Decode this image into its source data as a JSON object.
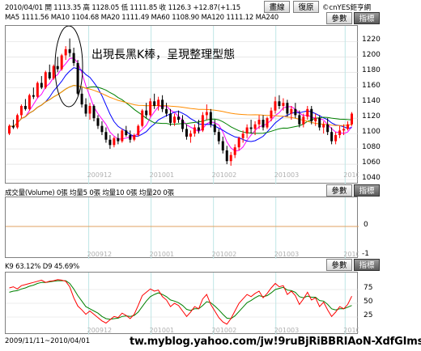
{
  "header": {
    "quote_line": "2010/04/01 開 1113.35 高 1128.05 低 1111.85 收 1126.3 +12.87(+1.15",
    "ma_line": "MA5 1111.56   MA10 1104.68   MA20 1111.49   MA60 1108.90   MA120 1111.12   MA240"
  },
  "toolbar": {
    "draw_line": "畫線",
    "restore": "復原",
    "params": "參數",
    "indicator": "指標"
  },
  "copyright": "©cnYES鉅亨網",
  "annotation": "出現長黑K棒，呈現整理型態",
  "volume_panel": {
    "header": "成交量(Volume) 0張    均量5 0張    均量10 0張    均量20 0張",
    "params": "參數",
    "indicator": "指標"
  },
  "kd_panel": {
    "header": "K9 63.12%   D9 45.69%",
    "params": "參數",
    "indicator": "指標"
  },
  "footer": {
    "range": "2009/11/11~2010/04/01",
    "watermark": "tw.myblog.yahoo.com/jw!9ruBjRiBBRIAoN-XdfGImss-",
    "faint_url": "www.cnyes.com"
  },
  "chart_data": [
    {
      "type": "candlestick",
      "y_ticks": [
        1220,
        1200,
        1180,
        1160,
        1140,
        1120,
        1100,
        1080,
        1060,
        1040
      ],
      "ylim": [
        1040,
        1232
      ],
      "x_labels": [
        "200912",
        "201001",
        "201002",
        "201003",
        "201004"
      ],
      "grid": true,
      "up_color": "#ff0000",
      "down_color": "#000000",
      "ma_lines": [
        {
          "name": "MA5",
          "color": "#ff00ff"
        },
        {
          "name": "MA10",
          "color": "#0000ff"
        },
        {
          "name": "MA20",
          "color": "#008000"
        },
        {
          "name": "MA60",
          "color": "#ff8c00"
        }
      ],
      "candles": [
        [
          1100,
          1112,
          1098,
          1110
        ],
        [
          1110,
          1118,
          1106,
          1108
        ],
        [
          1108,
          1126,
          1106,
          1124
        ],
        [
          1124,
          1138,
          1120,
          1136
        ],
        [
          1136,
          1145,
          1130,
          1132
        ],
        [
          1132,
          1152,
          1130,
          1150
        ],
        [
          1150,
          1160,
          1145,
          1148
        ],
        [
          1148,
          1168,
          1146,
          1166
        ],
        [
          1166,
          1175,
          1158,
          1160
        ],
        [
          1160,
          1182,
          1158,
          1180
        ],
        [
          1180,
          1190,
          1170,
          1172
        ],
        [
          1172,
          1190,
          1170,
          1188
        ],
        [
          1188,
          1200,
          1180,
          1184
        ],
        [
          1184,
          1204,
          1182,
          1202
        ],
        [
          1202,
          1214,
          1196,
          1210
        ],
        [
          1210,
          1224,
          1200,
          1205
        ],
        [
          1205,
          1212,
          1188,
          1192
        ],
        [
          1192,
          1196,
          1150,
          1152
        ],
        [
          1152,
          1160,
          1134,
          1138
        ],
        [
          1138,
          1146,
          1122,
          1126
        ],
        [
          1126,
          1140,
          1118,
          1136
        ],
        [
          1136,
          1138,
          1116,
          1120
        ],
        [
          1120,
          1124,
          1106,
          1110
        ],
        [
          1110,
          1116,
          1098,
          1102
        ],
        [
          1102,
          1108,
          1088,
          1092
        ],
        [
          1092,
          1098,
          1080,
          1085
        ],
        [
          1085,
          1096,
          1082,
          1094
        ],
        [
          1094,
          1100,
          1086,
          1090
        ],
        [
          1090,
          1106,
          1088,
          1104
        ],
        [
          1104,
          1110,
          1096,
          1098
        ],
        [
          1098,
          1104,
          1088,
          1092
        ],
        [
          1092,
          1100,
          1090,
          1098
        ],
        [
          1098,
          1112,
          1096,
          1110
        ],
        [
          1110,
          1132,
          1108,
          1130
        ],
        [
          1130,
          1140,
          1120,
          1124
        ],
        [
          1124,
          1146,
          1122,
          1142
        ],
        [
          1142,
          1152,
          1132,
          1136
        ],
        [
          1136,
          1148,
          1130,
          1144
        ],
        [
          1144,
          1150,
          1128,
          1132
        ],
        [
          1132,
          1140,
          1122,
          1126
        ],
        [
          1126,
          1132,
          1110,
          1114
        ],
        [
          1114,
          1126,
          1110,
          1122
        ],
        [
          1122,
          1130,
          1114,
          1118
        ],
        [
          1118,
          1124,
          1102,
          1106
        ],
        [
          1106,
          1112,
          1092,
          1096
        ],
        [
          1096,
          1104,
          1088,
          1100
        ],
        [
          1100,
          1112,
          1096,
          1108
        ],
        [
          1108,
          1118,
          1100,
          1104
        ],
        [
          1104,
          1128,
          1102,
          1124
        ],
        [
          1124,
          1138,
          1118,
          1128
        ],
        [
          1128,
          1132,
          1108,
          1112
        ],
        [
          1112,
          1118,
          1098,
          1102
        ],
        [
          1102,
          1106,
          1086,
          1090
        ],
        [
          1090,
          1096,
          1074,
          1078
        ],
        [
          1078,
          1084,
          1060,
          1064
        ],
        [
          1064,
          1076,
          1058,
          1072
        ],
        [
          1072,
          1086,
          1068,
          1082
        ],
        [
          1082,
          1096,
          1078,
          1094
        ],
        [
          1094,
          1104,
          1088,
          1100
        ],
        [
          1100,
          1112,
          1094,
          1108
        ],
        [
          1108,
          1118,
          1100,
          1106
        ],
        [
          1106,
          1116,
          1098,
          1112
        ],
        [
          1112,
          1124,
          1106,
          1118
        ],
        [
          1118,
          1124,
          1104,
          1108
        ],
        [
          1108,
          1122,
          1106,
          1120
        ],
        [
          1120,
          1134,
          1116,
          1130
        ],
        [
          1130,
          1148,
          1126,
          1142
        ],
        [
          1142,
          1150,
          1132,
          1136
        ],
        [
          1136,
          1146,
          1130,
          1140
        ],
        [
          1140,
          1144,
          1122,
          1126
        ],
        [
          1126,
          1136,
          1118,
          1132
        ],
        [
          1132,
          1140,
          1120,
          1124
        ],
        [
          1124,
          1130,
          1108,
          1112
        ],
        [
          1112,
          1126,
          1108,
          1122
        ],
        [
          1122,
          1136,
          1118,
          1132
        ],
        [
          1132,
          1136,
          1112,
          1116
        ],
        [
          1116,
          1126,
          1110,
          1120
        ],
        [
          1120,
          1124,
          1104,
          1108
        ],
        [
          1108,
          1116,
          1100,
          1112
        ],
        [
          1112,
          1120,
          1098,
          1102
        ],
        [
          1102,
          1108,
          1086,
          1090
        ],
        [
          1090,
          1102,
          1086,
          1098
        ],
        [
          1098,
          1110,
          1094,
          1104
        ],
        [
          1104,
          1112,
          1098,
          1106
        ],
        [
          1106,
          1116,
          1104,
          1112
        ],
        [
          1112,
          1128,
          1110,
          1126
        ]
      ]
    },
    {
      "type": "bar",
      "series": [
        {
          "name": "成交量(Volume)",
          "values": [
            0
          ]
        }
      ],
      "y_ticks": [
        0,
        -1
      ],
      "x_labels": [
        "200912",
        "201001",
        "201002",
        "201003",
        "201004"
      ]
    },
    {
      "type": "line",
      "series": [
        {
          "name": "K9",
          "color": "#ff0000"
        },
        {
          "name": "D9",
          "color": "#008000"
        }
      ],
      "y_ticks": [
        75,
        50,
        25
      ],
      "ylim": [
        0,
        100
      ],
      "x_labels": [
        "200912",
        "201001",
        "201002",
        "201003",
        "201004"
      ],
      "K": [
        78,
        80,
        76,
        82,
        84,
        86,
        88,
        90,
        92,
        88,
        90,
        91,
        93,
        92,
        90,
        80,
        60,
        45,
        38,
        30,
        36,
        30,
        24,
        18,
        14,
        20,
        26,
        24,
        32,
        28,
        22,
        30,
        46,
        64,
        70,
        76,
        72,
        74,
        62,
        56,
        44,
        50,
        46,
        36,
        26,
        34,
        44,
        40,
        58,
        66,
        48,
        36,
        24,
        16,
        12,
        22,
        36,
        50,
        58,
        66,
        62,
        68,
        72,
        60,
        68,
        78,
        86,
        80,
        82,
        66,
        72,
        64,
        48,
        58,
        70,
        56,
        60,
        44,
        52,
        38,
        26,
        34,
        44,
        40,
        48,
        63
      ],
      "D": [
        70,
        72,
        73,
        76,
        78,
        81,
        83,
        86,
        88,
        88,
        89,
        90,
        91,
        91,
        91,
        86,
        76,
        64,
        54,
        44,
        40,
        36,
        32,
        26,
        22,
        21,
        22,
        23,
        26,
        27,
        26,
        28,
        34,
        44,
        54,
        62,
        66,
        69,
        66,
        62,
        56,
        54,
        51,
        46,
        39,
        37,
        40,
        40,
        46,
        53,
        51,
        45,
        38,
        30,
        23,
        22,
        27,
        35,
        43,
        51,
        55,
        60,
        64,
        62,
        64,
        69,
        75,
        77,
        79,
        74,
        73,
        70,
        62,
        60,
        63,
        61,
        61,
        55,
        54,
        48,
        40,
        38,
        40,
        40,
        43,
        46
      ]
    }
  ]
}
